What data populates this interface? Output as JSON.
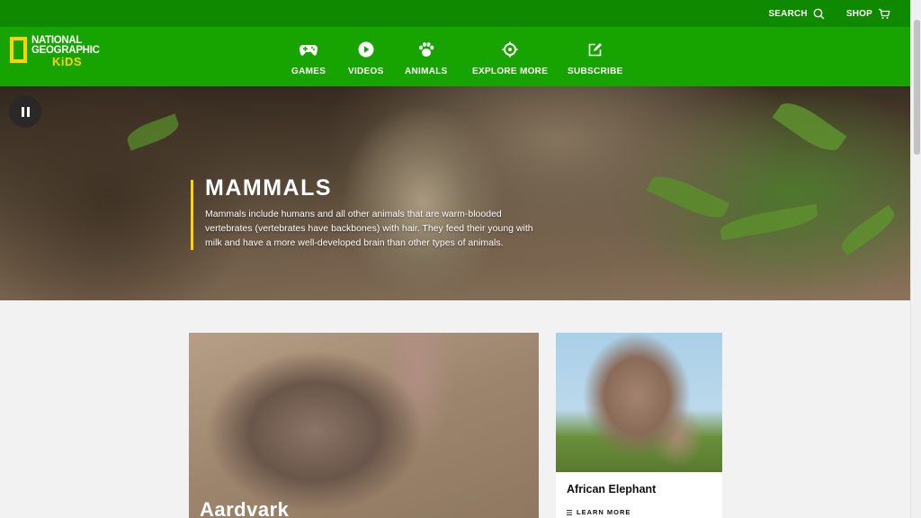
{
  "topbar": {
    "search_label": "SEARCH",
    "search_icon": "search-icon",
    "shop_label": "SHOP",
    "shop_icon": "cart-icon"
  },
  "brand": {
    "line1": "NATIONAL",
    "line2": "GEOGRAPHIC",
    "line3": "KiDS",
    "colors": {
      "green": "#17a300",
      "dark_green": "#0f8a00",
      "yellow": "#ffd200"
    }
  },
  "nav": {
    "items": [
      {
        "label": "GAMES",
        "icon": "gamepad-icon"
      },
      {
        "label": "VIDEOS",
        "icon": "play-icon"
      },
      {
        "label": "ANIMALS",
        "icon": "paw-icon"
      },
      {
        "label": "EXPLORE MORE",
        "icon": "target-icon"
      },
      {
        "label": "SUBSCRIBE",
        "icon": "edit-icon"
      }
    ]
  },
  "hero": {
    "title": "MAMMALS",
    "description": "Mammals include humans and all other animals that are warm-blooded vertebrates (vertebrates have backbones) with hair. They feed their young with milk and have a more well-developed brain than other types of animals.",
    "pause_icon": "pause-icon"
  },
  "cards": {
    "featured": {
      "name": "Aardvark"
    },
    "side": {
      "name": "African Elephant",
      "cta": "LEARN MORE"
    }
  }
}
